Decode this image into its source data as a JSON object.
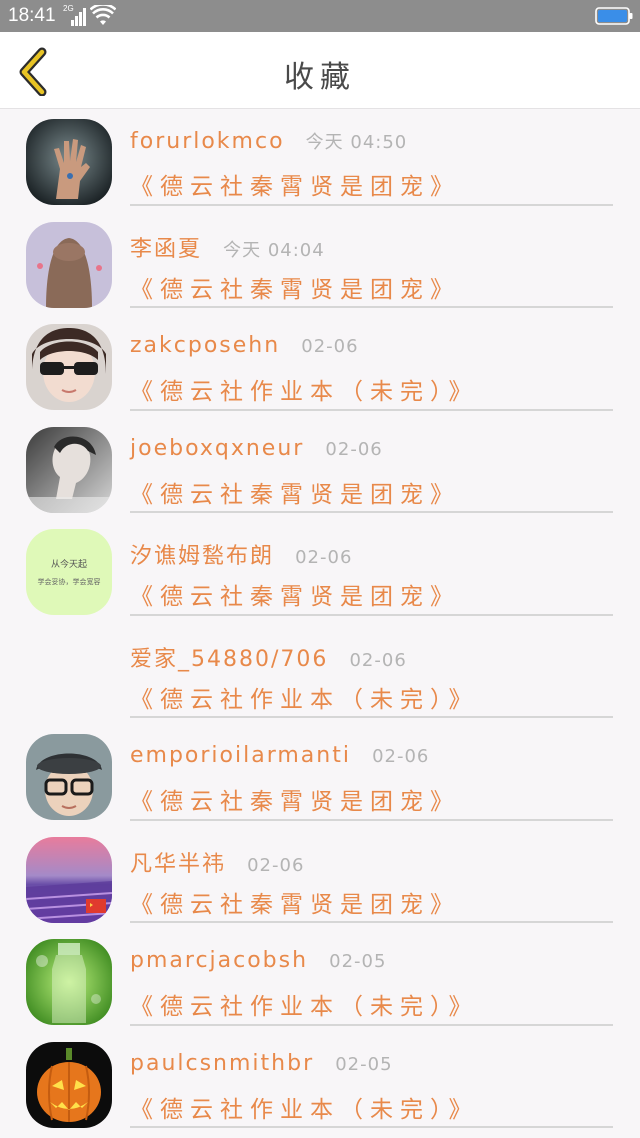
{
  "status_bar": {
    "time": "18:41",
    "network": "2G",
    "battery_color": "#3a8ee8"
  },
  "header": {
    "title": "收藏",
    "back_icon": "chevron-left-icon",
    "accent_color": "#e8c425"
  },
  "items": [
    {
      "name": "forurlokmco",
      "time": "今天 04:50",
      "title": "《德云社秦霄贤是团宠》",
      "avatar": "hand-avatar"
    },
    {
      "name": "李函夏",
      "time": "今天 04:04",
      "title": "《德云社秦霄贤是团宠》",
      "avatar": "girl-avatar"
    },
    {
      "name": "zakcposehn",
      "time": "02-06",
      "title": "《德云社作业本（未完）》",
      "avatar": "sunglasses-avatar"
    },
    {
      "name": "joeboxqxneur",
      "time": "02-06",
      "title": "《德云社秦霄贤是团宠》",
      "avatar": "profile-avatar"
    },
    {
      "name": "汐谯姆甃布朗",
      "time": "02-06",
      "title": "《德云社秦霄贤是团宠》",
      "avatar": "text-avatar",
      "avatar_text_1": "从今天起",
      "avatar_text_2": "学会妥协，学会宽容"
    },
    {
      "name": "爱家_54880/706",
      "time": "02-06",
      "title": "《德云社作业本（未完）》",
      "avatar": "none"
    },
    {
      "name": "emporioilarmanti",
      "time": "02-06",
      "title": "《德云社秦霄贤是团宠》",
      "avatar": "boy-avatar"
    },
    {
      "name": "凡华半祎",
      "time": "02-06",
      "title": "《德云社秦霄贤是团宠》",
      "avatar": "lavender-avatar"
    },
    {
      "name": "pmarcjacobsh",
      "time": "02-05",
      "title": "《德云社作业本（未完）》",
      "avatar": "bottle-avatar"
    },
    {
      "name": "paulcsnmithbr",
      "time": "02-05",
      "title": "《德云社作业本（未完）》",
      "avatar": "pumpkin-avatar"
    }
  ]
}
